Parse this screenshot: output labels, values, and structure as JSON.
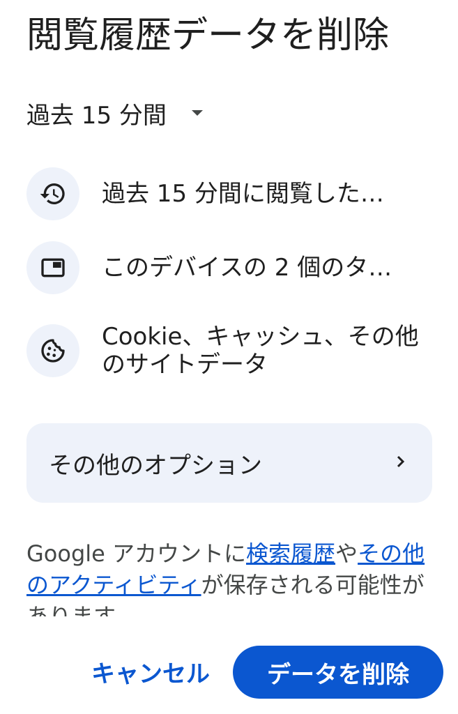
{
  "dialog": {
    "title": "閲覧履歴データを削除"
  },
  "time_range": {
    "selected": "過去 15 分間",
    "icon": "arrow-drop-down-icon"
  },
  "items": [
    {
      "icon": "history-icon",
      "label": "過去 15 分間に閲覧した…"
    },
    {
      "icon": "tab-icon",
      "label": "このデバイスの 2 個のタ…"
    },
    {
      "icon": "cookie-icon",
      "label": "Cookie、キャッシュ、その他のサイトデータ"
    }
  ],
  "more_options": {
    "label": "その他のオプション",
    "icon": "chevron-right-icon"
  },
  "notice": {
    "prefix": "Google アカウントに",
    "link1": "検索履歴",
    "middle": "や",
    "link2": "その他のアクティビティ",
    "suffix": "が保存される可能性があります"
  },
  "actions": {
    "cancel": "キャンセル",
    "delete": "データを削除"
  },
  "colors": {
    "accent": "#0b57d0",
    "surface": "#eef2fa",
    "text": "#1f1f1f"
  }
}
